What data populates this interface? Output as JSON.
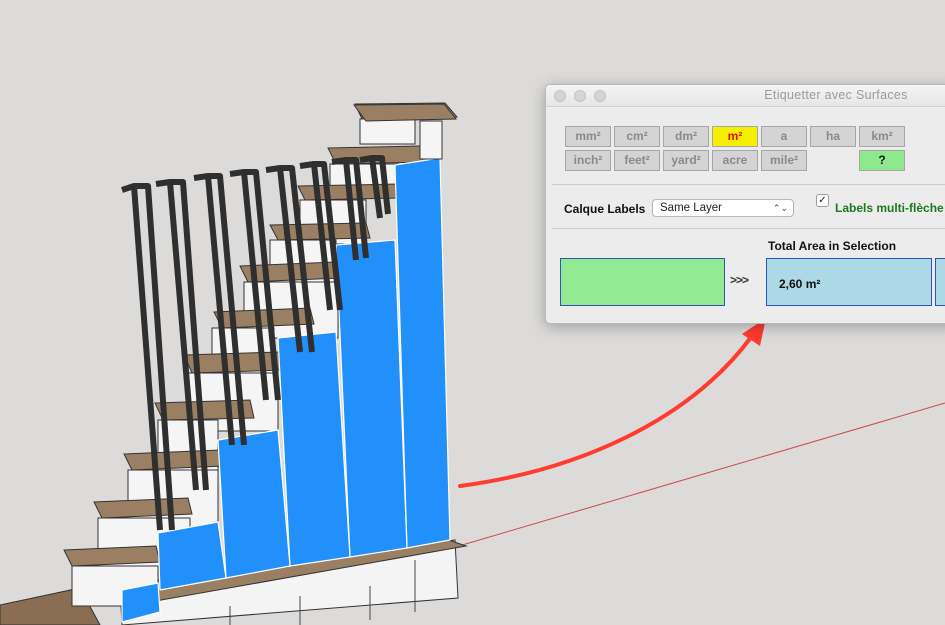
{
  "window": {
    "title": "Etiquetter avec Surfaces"
  },
  "units": {
    "row1": [
      "mm²",
      "cm²",
      "dm²",
      "m²",
      "a",
      "ha",
      "km²"
    ],
    "row2": [
      "inch²",
      "feet²",
      "yard²",
      "acre",
      "mile²",
      "",
      "?"
    ],
    "active": "m²"
  },
  "calque": {
    "label": "Calque Labels",
    "value": "Same Layer"
  },
  "multi_fleche": {
    "label": "Labels multi-flèche",
    "checked": true,
    "mark": "✓"
  },
  "total": {
    "label": "Total Area in Selection",
    "arrows": ">>>",
    "value": "2,60 m²"
  },
  "colors": {
    "stair_face": "#2190fa",
    "tread": "#9b7f62",
    "baluster": "#3a3a3a",
    "annotation_arrow": "#ff3b2e",
    "axis_line": "#d24848"
  }
}
